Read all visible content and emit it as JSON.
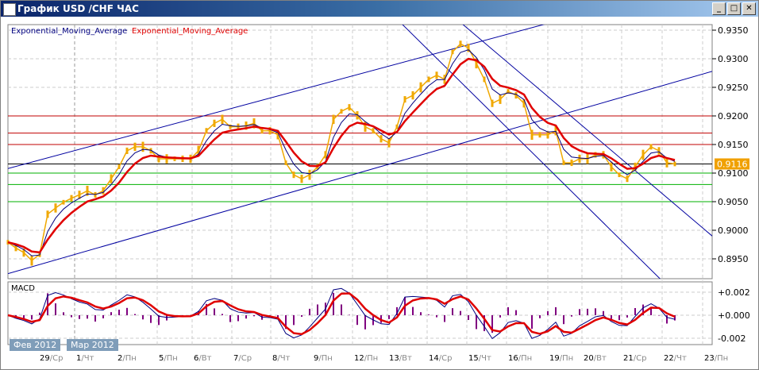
{
  "window": {
    "title": "График USD /CHF  ЧАС",
    "buttons": {
      "minimize": "_",
      "maximize": "□",
      "close": "✕"
    }
  },
  "legend": {
    "ema1": "Exponential_Moving_Average",
    "ema2": "Exponential_Moving_Average",
    "ema1_color": "#000080",
    "ema2_color": "#e00000"
  },
  "macd_label": "MACD",
  "month_tags": [
    "Фев 2012",
    "Мар 2012"
  ],
  "colors": {
    "price": "#f0a800",
    "ema_fast": "#000080",
    "ema_slow": "#e00000",
    "histogram": "#800080",
    "current_bg": "#f0a000"
  },
  "chart_data": {
    "type": "line",
    "title": "График USD /CHF  ЧАС",
    "ylim": [
      0.8925,
      0.9375
    ],
    "price_ticks": [
      "0.9350",
      "0.9300",
      "0.9250",
      "0.9200",
      "0.9150",
      "0.9100",
      "0.9050",
      "0.9000",
      "0.8950"
    ],
    "current_price": "0.9116",
    "macd_ticks": [
      "+0.002",
      "+0.000",
      "-0.002"
    ],
    "time_labels": [
      [
        "29",
        "Ср"
      ],
      [
        "1",
        "Чт"
      ],
      [
        "2",
        "Пн"
      ],
      [
        "5",
        "Пн"
      ],
      [
        "6",
        "Вт"
      ],
      [
        "7",
        "Ср"
      ],
      [
        "8",
        "Чт"
      ],
      [
        "9",
        "Пн"
      ],
      [
        "12",
        "Пн"
      ],
      [
        "13",
        "Вт"
      ],
      [
        "14",
        "Ср"
      ],
      [
        "15",
        "Чт"
      ],
      [
        "16",
        "Пн"
      ],
      [
        "19",
        "Пн"
      ],
      [
        "20",
        "Вт"
      ],
      [
        "21",
        "Ср"
      ],
      [
        "22",
        "Чт"
      ],
      [
        "23",
        "Пн"
      ]
    ],
    "close": [
      0.8979,
      0.8969,
      0.8961,
      0.8947,
      0.8958,
      0.9028,
      0.9039,
      0.9049,
      0.9056,
      0.9062,
      0.9069,
      0.9062,
      0.9069,
      0.909,
      0.9111,
      0.9139,
      0.9146,
      0.9146,
      0.9139,
      0.9125,
      0.9125,
      0.9125,
      0.9125,
      0.9125,
      0.9139,
      0.9174,
      0.9187,
      0.9194,
      0.9181,
      0.9181,
      0.9183,
      0.9187,
      0.9174,
      0.9174,
      0.9167,
      0.9118,
      0.9097,
      0.909,
      0.9097,
      0.9111,
      0.9132,
      0.9194,
      0.9208,
      0.9215,
      0.9201,
      0.9181,
      0.9174,
      0.916,
      0.9153,
      0.9181,
      0.9229,
      0.9236,
      0.925,
      0.9264,
      0.9271,
      0.9264,
      0.9312,
      0.9326,
      0.9319,
      0.9292,
      0.9264,
      0.9222,
      0.9229,
      0.9243,
      0.9236,
      0.9222,
      0.9167,
      0.9167,
      0.9167,
      0.9174,
      0.9118,
      0.9118,
      0.9125,
      0.9125,
      0.9132,
      0.9132,
      0.9111,
      0.9097,
      0.909,
      0.9111,
      0.9132,
      0.9146,
      0.9139,
      0.9118,
      0.9116
    ],
    "hlines": [
      {
        "price": 0.92,
        "color": "#c00000"
      },
      {
        "price": 0.917,
        "color": "#c00000"
      },
      {
        "price": 0.915,
        "color": "#c00000"
      },
      {
        "price": 0.9116,
        "color": "#000000"
      },
      {
        "price": 0.91,
        "color": "#00b000"
      },
      {
        "price": 0.908,
        "color": "#00b000"
      },
      {
        "price": 0.905,
        "color": "#00b000"
      }
    ],
    "trendlines": [
      [
        [
          0,
          0.9108
        ],
        [
          67.5,
          0.936
        ]
      ],
      [
        [
          5,
          0.8944
        ],
        [
          88.7,
          0.9278
        ]
      ],
      [
        [
          54.5,
          0.9294
        ],
        [
          82,
          0.8917
        ]
      ],
      [
        [
          59,
          0.934
        ],
        [
          88.7,
          0.899
        ]
      ]
    ]
  }
}
